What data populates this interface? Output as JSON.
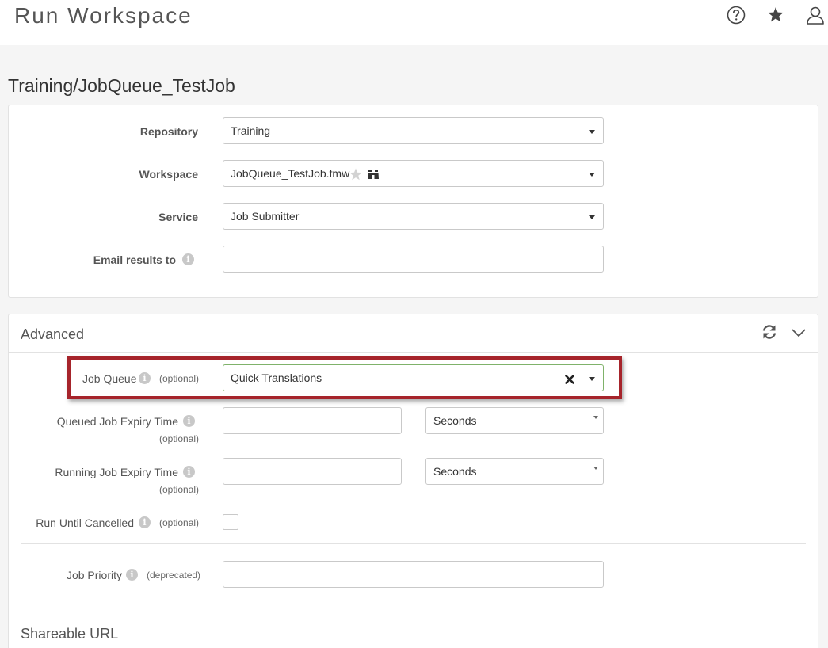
{
  "header": {
    "app_title": "Run Workspace",
    "icons": [
      "help-icon",
      "star-icon",
      "user-icon"
    ]
  },
  "workspace_title": "Training/JobQueue_TestJob",
  "main_form": {
    "repository": {
      "label": "Repository",
      "value": "Training"
    },
    "workspace": {
      "label": "Workspace",
      "value": "JobQueue_TestJob.fmw"
    },
    "service": {
      "label": "Service",
      "value": "Job Submitter"
    },
    "email": {
      "label": "Email results to",
      "value": ""
    }
  },
  "advanced": {
    "title": "Advanced",
    "job_queue": {
      "label": "Job Queue",
      "optional": "(optional)",
      "value": "Quick Translations"
    },
    "queued_expiry": {
      "label": "Queued Job Expiry Time",
      "optional": "(optional)",
      "value": "",
      "unit": "Seconds"
    },
    "running_expiry": {
      "label": "Running Job Expiry Time",
      "optional": "(optional)",
      "value": "",
      "unit": "Seconds"
    },
    "run_until_cancelled": {
      "label": "Run Until Cancelled",
      "optional": "(optional)",
      "checked": false
    },
    "job_priority": {
      "label": "Job Priority",
      "note": "(deprecated)",
      "value": ""
    },
    "shareable_url": {
      "label": "Shareable URL"
    }
  },
  "colors": {
    "highlight": "#a6242b",
    "focus_border": "#7fb26a"
  }
}
